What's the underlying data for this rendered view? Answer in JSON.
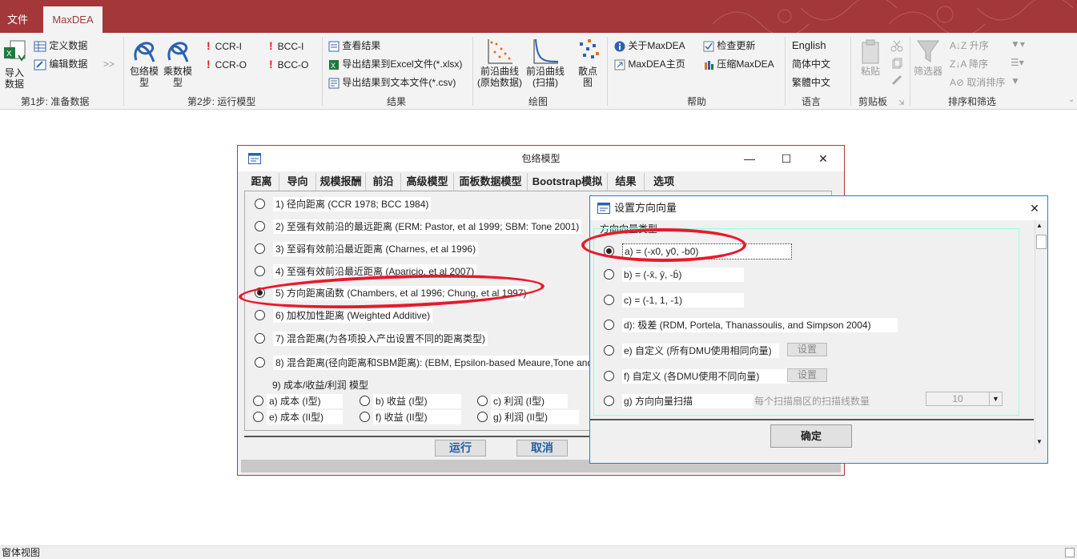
{
  "titlebar": {
    "tabs": [
      "文件",
      "MaxDEA"
    ],
    "accent": "#a4373a"
  },
  "ribbon": {
    "step1": {
      "import": "导入数据",
      "define": "定义数据",
      "edit": "编辑数据",
      "arrows": ">>",
      "label": "第1步: 准备数据"
    },
    "step2": {
      "envelope": "包络模型",
      "multiplier": "乘数模型",
      "ccri": "CCR-I",
      "ccro": "CCR-O",
      "bcci": "BCC-I",
      "bcco": "BCC-O",
      "label": "第2步: 运行模型"
    },
    "results": {
      "view": "查看结果",
      "excel": "导出结果到Excel文件(*.xlsx)",
      "text": "导出结果到文本文件(*.csv)",
      "label": "结果"
    },
    "plot": {
      "frontier_raw": "前沿曲线(原始数据)",
      "frontier_scan": "前沿曲线(扫描)",
      "scatter": "散点图",
      "label": "绘图"
    },
    "help": {
      "about": "关于MaxDEA",
      "home": "MaxDEA主页",
      "update": "检查更新",
      "compress": "压缩MaxDEA",
      "label": "帮助"
    },
    "language": {
      "en": "English",
      "sc": "简体中文",
      "tc": "繁體中文",
      "label": "语言"
    },
    "clipboard": {
      "paste": "粘贴",
      "label": "剪贴板"
    },
    "sort": {
      "filter": "筛选器",
      "asc": "升序",
      "desc": "降序",
      "clear": "取消排序",
      "label": "排序和筛选"
    }
  },
  "status": "窗体视图",
  "env_dialog": {
    "title": "包络模型",
    "tabs": [
      "距离",
      "导向",
      "规模报酬",
      "前沿",
      "高级模型",
      "面板数据模型",
      "Bootstrap模拟",
      "结果",
      "选项"
    ],
    "options": [
      "1) 径向距离 (CCR 1978; BCC 1984)",
      "2) 至强有效前沿的最远距离 (ERM: Pastor, et al 1999; SBM: Tone 2001)",
      "3) 至弱有效前沿最近距离 (Charnes, et al 1996)",
      "4) 至强有效前沿最近距离 (Aparicio, et al 2007)",
      "5) 方向距离函数 (Chambers, et al 1996; Chung, et al 1997)",
      "6) 加权加性距离 (Weighted Additive)",
      "7) 混合距离(为各项投入产出设置不同的距离类型)",
      "8) 混合距离(径向距离和SBM距离): (EBM, Epsilon-based Meaure,Tone and"
    ],
    "selected_index": 4,
    "cost_title": "9) 成本/收益/利润 模型",
    "cost_options": [
      "a) 成本 (I型)",
      "b) 收益 (I型)",
      "c) 利润 (I型)",
      "e) 成本 (II型)",
      "f) 收益 (II型)",
      "g) 利润 (II型)"
    ],
    "run": "运行",
    "cancel": "取消"
  },
  "dir_dialog": {
    "title": "设置方向向量",
    "group_label": "方向向量类型",
    "options": [
      "a) = (-x0, y0, -b0)",
      "b) = (-x̄, ȳ, -b̄)",
      "c) = (-1, 1, -1)",
      "d): 极差 (RDM, Portela, Thanassoulis, and Simpson 2004)",
      "e) 自定义 (所有DMU使用相同向量)",
      "f) 自定义 (各DMU使用不同向量)",
      "g) 方向向量扫描"
    ],
    "set_label": "设置",
    "scan_label": "每个扫描扇区的扫描线数量",
    "scan_value": "10",
    "ok": "确定"
  }
}
